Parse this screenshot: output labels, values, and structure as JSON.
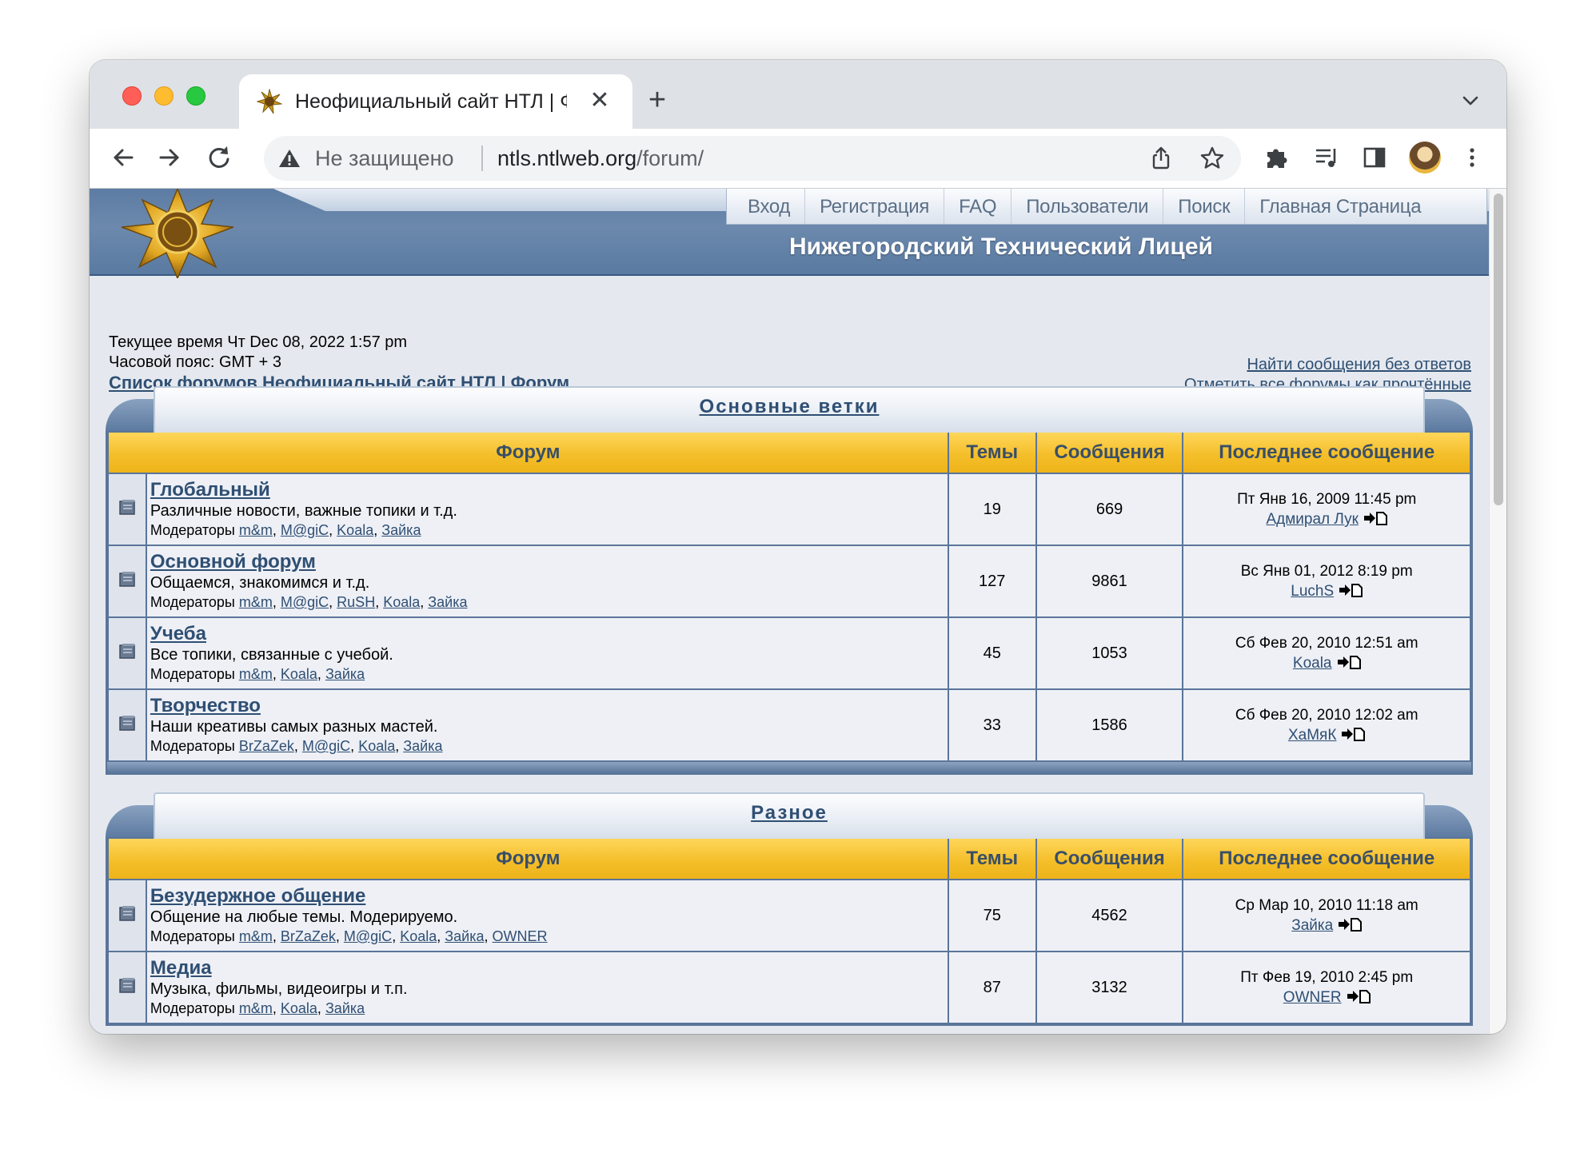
{
  "browser": {
    "tab_title": "Неофициальный сайт НТЛ | Ф",
    "omnibox_security": "Не защищено",
    "omnibox_host": "ntls.ntlweb.org",
    "omnibox_path": "/forum/"
  },
  "site": {
    "menu": [
      "Вход",
      "Регистрация",
      "FAQ",
      "Пользователи",
      "Поиск",
      "Главная Страница"
    ],
    "title": "Нижегородский Технический Лицей"
  },
  "info": {
    "current_time": "Текущее время Чт Dec 08, 2022 1:57 pm",
    "timezone": "Часовой пояс: GMT + 3",
    "forum_index": "Список форумов Неофициальный сайт НТЛ | Форум",
    "unanswered": "Найти сообщения без ответов",
    "mark_read": "Отметить все форумы как прочтённые"
  },
  "columns": {
    "forum": "Форум",
    "topics": "Темы",
    "posts": "Сообщения",
    "last": "Последнее сообщение"
  },
  "moderators_label": "Модераторы",
  "categories": [
    {
      "title": "Основные ветки",
      "forums": [
        {
          "name": "Глобальный",
          "desc": "Различные новости, важные топики и т.д.",
          "mods": [
            "m&m",
            "M@giC",
            "Koala",
            "Зайка"
          ],
          "topics": "19",
          "posts": "669",
          "last_date": "Пт Янв 16, 2009 11:45 pm",
          "last_user": "Адмирал Лук"
        },
        {
          "name": "Основной форум",
          "desc": "Общаемся, знакомимся и т.д.",
          "mods": [
            "m&m",
            "M@giC",
            "RuSH",
            "Koala",
            "Зайка"
          ],
          "topics": "127",
          "posts": "9861",
          "last_date": "Вс Янв 01, 2012 8:19 pm",
          "last_user": "LuchS"
        },
        {
          "name": "Учеба",
          "desc": "Все топики, связанные с учебой.",
          "mods": [
            "m&m",
            "Koala",
            "Зайка"
          ],
          "topics": "45",
          "posts": "1053",
          "last_date": "Сб Фев 20, 2010 12:51 am",
          "last_user": "Koala"
        },
        {
          "name": "Творчество",
          "desc": "Наши креативы самых разных мастей.",
          "mods": [
            "BrZaZek",
            "M@giC",
            "Koala",
            "Зайка"
          ],
          "topics": "33",
          "posts": "1586",
          "last_date": "Сб Фев 20, 2010 12:02 am",
          "last_user": "ХаМяК"
        }
      ]
    },
    {
      "title": "Разное",
      "forums": [
        {
          "name": "Безудержное общение",
          "desc": "Общение на любые темы. Модерируемо.",
          "mods": [
            "m&m",
            "BrZaZek",
            "M@giC",
            "Koala",
            "Зайка",
            "OWNER"
          ],
          "topics": "75",
          "posts": "4562",
          "last_date": "Ср Мар 10, 2010 11:18 am",
          "last_user": "Зайка"
        },
        {
          "name": "Медиа",
          "desc": "Музыка, фильмы, видеоигры и т.п.",
          "mods": [
            "m&m",
            "Koala",
            "Зайка"
          ],
          "topics": "87",
          "posts": "3132",
          "last_date": "Пт Фев 19, 2010 2:45 pm",
          "last_user": "OWNER"
        }
      ]
    }
  ],
  "icons": {
    "back": "arrow-left-icon",
    "forward": "arrow-right-icon",
    "reload": "reload-icon",
    "warning": "warning-triangle-icon",
    "share": "share-icon",
    "bookmark": "star-icon",
    "extensions": "puzzle-icon",
    "media": "media-queue-icon",
    "sidepanel": "side-panel-icon",
    "menu": "kebab-menu-icon",
    "forum": "folder-icon",
    "last_post": "view-latest-post-icon"
  },
  "colors": {
    "header_blue": "#5d7ca3",
    "table_header_yellow": "#f4bf2b",
    "link_blue": "#2f4f73",
    "cell_bg": "#eef0f6"
  }
}
